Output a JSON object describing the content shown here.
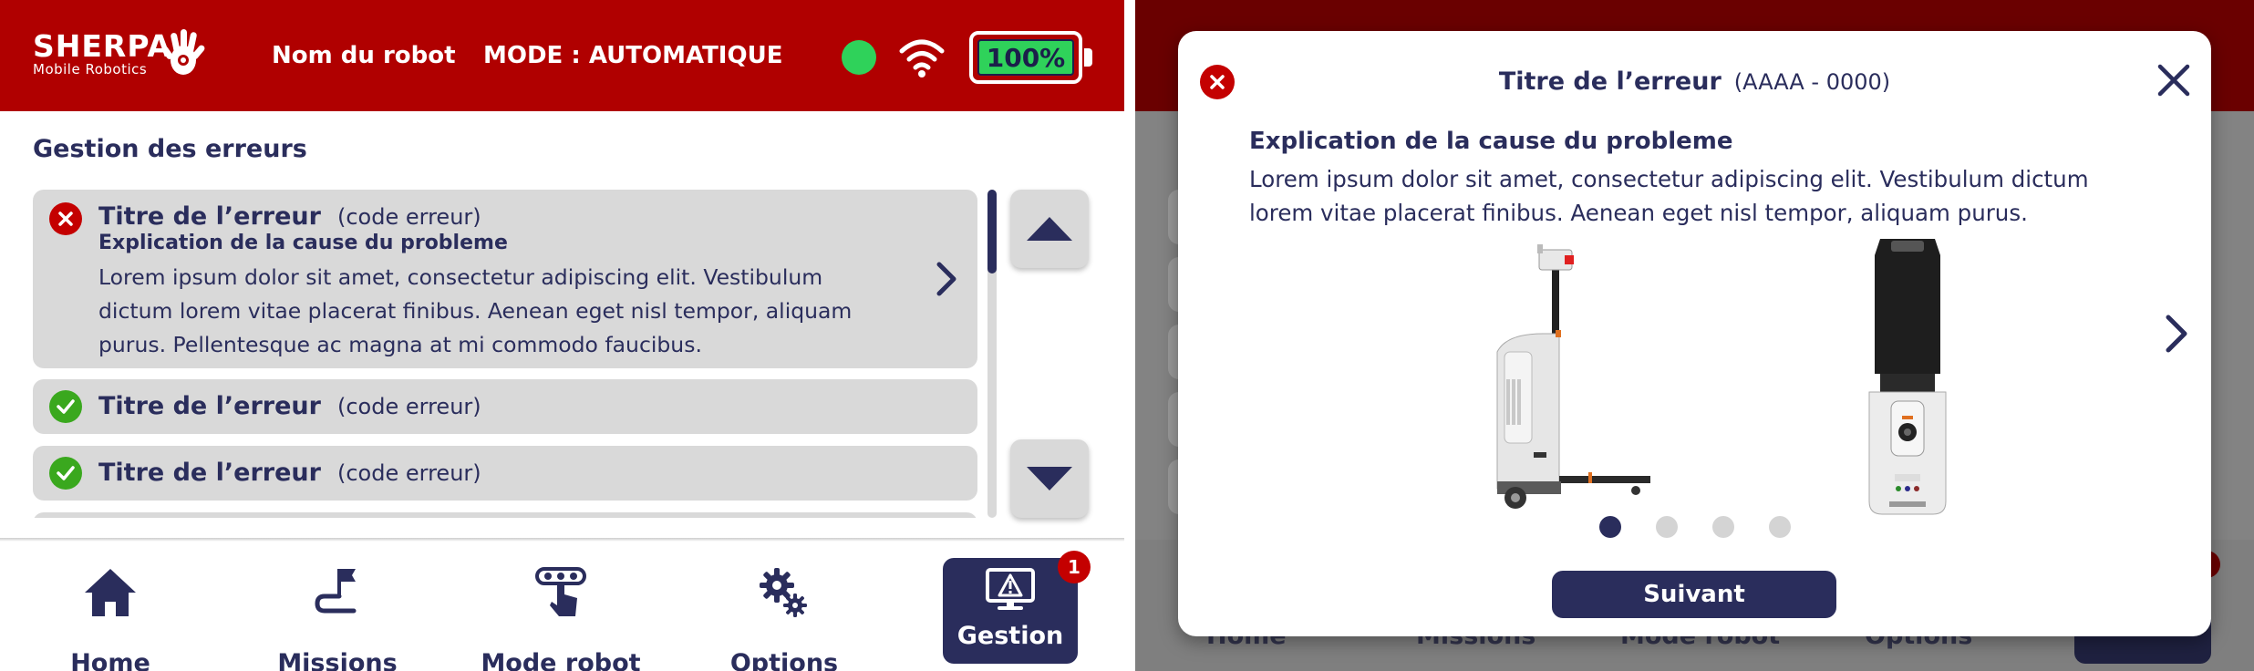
{
  "header": {
    "brand": "SHERPA",
    "brand_sub": "Mobile Robotics",
    "robot_name": "Nom du robot",
    "mode": "MODE : AUTOMATIQUE",
    "battery": "100%",
    "status_color": "#2fd25a",
    "bg_color": "#b00000"
  },
  "page": {
    "title": "Gestion des erreurs"
  },
  "errors": [
    {
      "status": "error",
      "title": "Titre de l’erreur",
      "code": "(code erreur)",
      "cause": "Explication de la cause du probleme",
      "description": "Lorem ipsum dolor sit amet, consectetur adipiscing elit. Vestibulum dictum lorem vitae placerat finibus. Aenean eget nisl tempor, aliquam purus. Pellentesque ac magna at mi commodo faucibus."
    },
    {
      "status": "ok",
      "title": "Titre de l’erreur",
      "code": "(code erreur)"
    },
    {
      "status": "ok",
      "title": "Titre de l’erreur",
      "code": "(code erreur)"
    }
  ],
  "nav": {
    "items": [
      {
        "label": "Home",
        "icon": "home-icon"
      },
      {
        "label": "Missions",
        "icon": "missions-icon"
      },
      {
        "label": "Mode robot",
        "icon": "mode-robot-icon"
      },
      {
        "label": "Options",
        "icon": "gears-icon"
      },
      {
        "label": "Gestion",
        "icon": "warning-monitor-icon",
        "active": true
      }
    ],
    "badge": "1"
  },
  "modal": {
    "title": "Titre de l’erreur",
    "code": "(AAAA - 0000)",
    "cause": "Explication de la cause du probleme",
    "description": "Lorem ipsum dolor sit amet, consectetur adipiscing elit. Vestibulum dictum lorem vitae placerat finibus. Aenean eget nisl tempor, aliquam purus.",
    "button": "Suivant",
    "pages": 4,
    "current_page": 1
  },
  "colors": {
    "primary": "#2a2d5c",
    "error": "#c40000",
    "success": "#3aa81e",
    "card": "#d9d9d9"
  }
}
